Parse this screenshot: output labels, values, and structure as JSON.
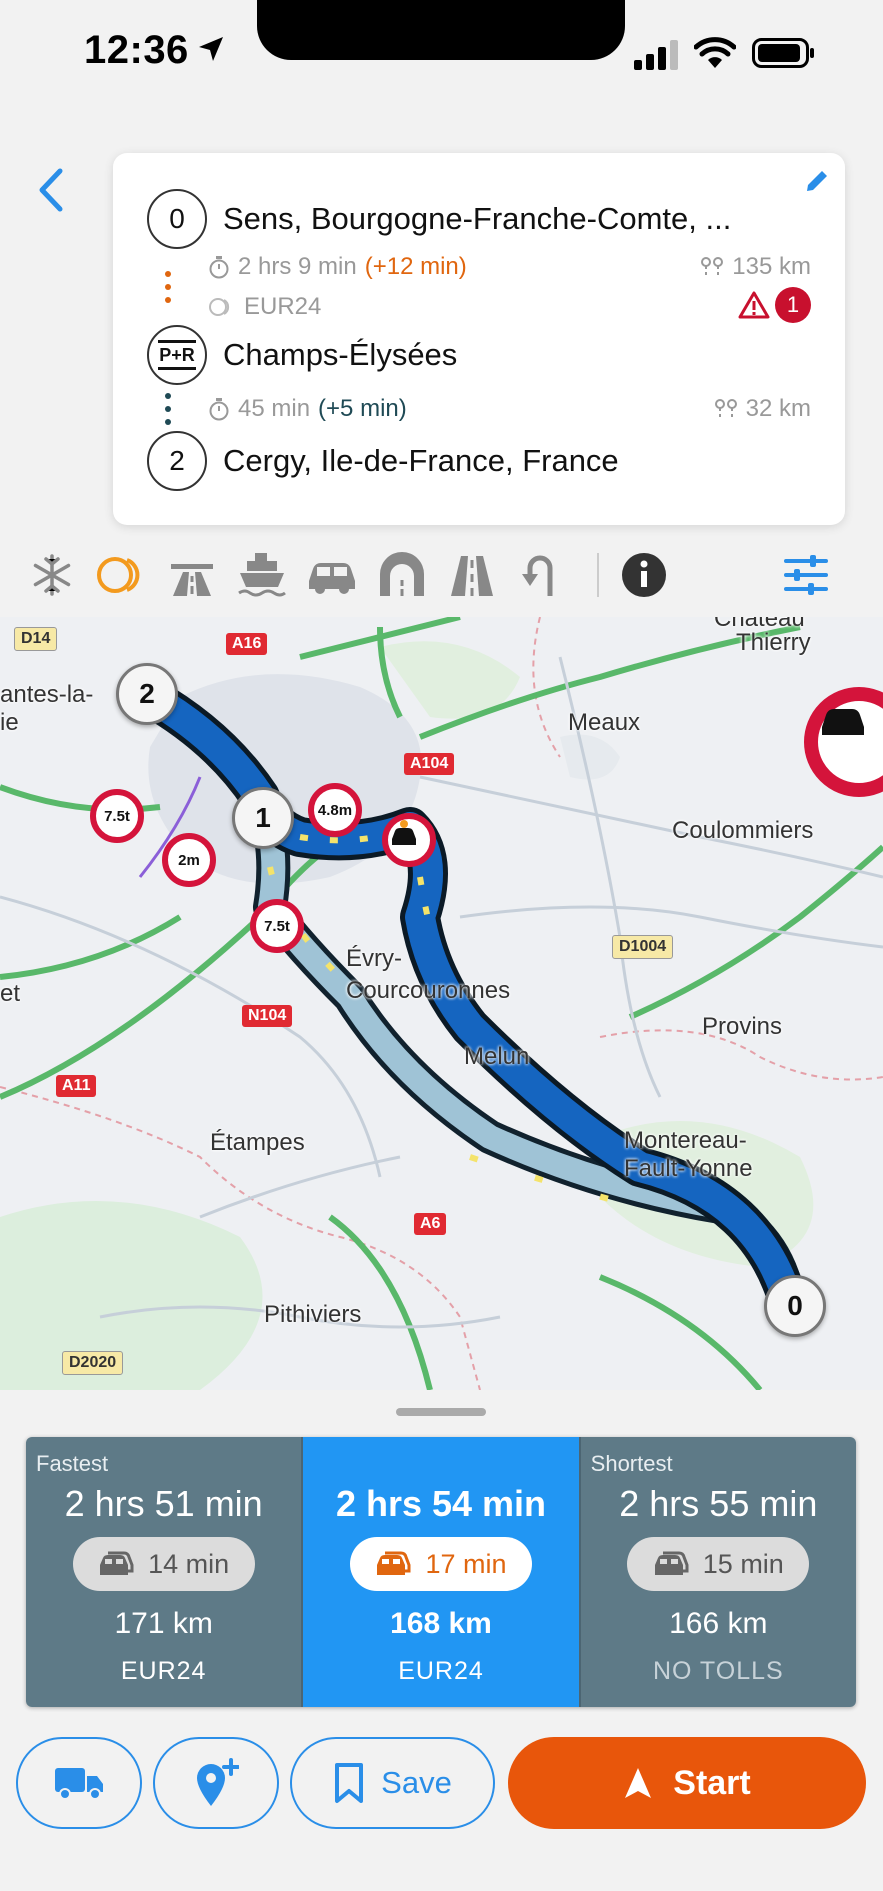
{
  "status_bar": {
    "time": "12:36"
  },
  "route": {
    "waypoints": [
      {
        "index": "0",
        "label": "Sens, Bourgogne-Franche-Comte, ..."
      },
      {
        "index": "P+R",
        "label": "Champs-Élysées"
      },
      {
        "index": "2",
        "label": "Cergy, Ile-de-France, France"
      }
    ],
    "legs": [
      {
        "duration": "2 hrs 9 min",
        "delay": "(+12 min)",
        "distance": "135 km",
        "toll": "EUR24",
        "warnings": "1"
      },
      {
        "duration": "45 min",
        "delay": "(+5 min)",
        "distance": "32 km"
      }
    ]
  },
  "map": {
    "labels": {
      "chateau": "Chateau",
      "thierry": "Thierry",
      "meaux": "Meaux",
      "coulommiers": "Coulommiers",
      "evry1": "Évry-",
      "evry2": "Courcouronnes",
      "melun": "Melun",
      "provins": "Provins",
      "montereau1": "Montereau-",
      "montereau2": "Fault-Yonne",
      "etampes": "Étampes",
      "pithiviers": "Pithiviers",
      "nantes1": "antes-la-",
      "nantes2": "ie",
      "et": "et"
    },
    "roads": {
      "d14": "D14",
      "a16": "A16",
      "a104": "A104",
      "d1004": "D1004",
      "n104": "N104",
      "a11": "A11",
      "a6": "A6",
      "d2020": "D2020"
    },
    "markers": {
      "m0": "0",
      "m1": "1",
      "m2": "2"
    },
    "restrictions": {
      "r1": "7.5t",
      "r2": "2m",
      "r3": "4.8m",
      "r4": "7.5t"
    }
  },
  "route_options": [
    {
      "type": "Fastest",
      "time": "2 hrs 51 min",
      "traffic": "14 min",
      "distance": "171 km",
      "toll": "EUR24"
    },
    {
      "type": "",
      "time": "2 hrs 54 min",
      "traffic": "17 min",
      "distance": "168 km",
      "toll": "EUR24"
    },
    {
      "type": "Shortest",
      "time": "2 hrs 55 min",
      "traffic": "15 min",
      "distance": "166 km",
      "toll": "NO TOLLS"
    }
  ],
  "actions": {
    "save_label": "Save",
    "start_label": "Start"
  },
  "colors": {
    "accent": "#2196f3",
    "start": "#e8560b",
    "route_main": "#1565c0",
    "route_alt": "#9fc3d6",
    "option_bg": "#5e7a87",
    "warning": "#c8102e"
  }
}
